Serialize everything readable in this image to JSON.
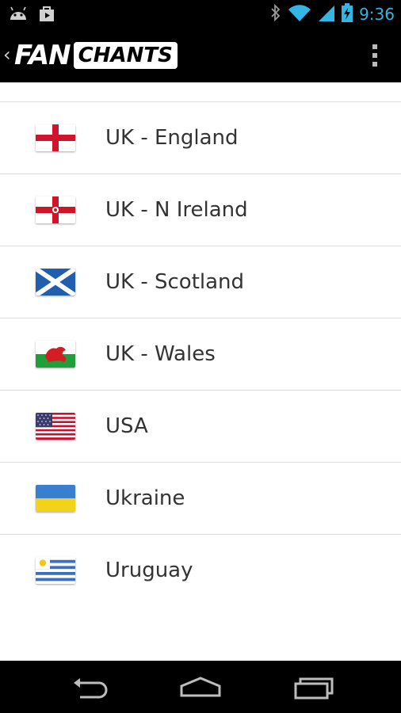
{
  "status_bar": {
    "time": "9:36",
    "icons": [
      "android-icon",
      "bag-icon",
      "bluetooth-icon",
      "wifi-icon",
      "signal-icon",
      "battery-icon"
    ]
  },
  "action_bar": {
    "back_icon": "back-chevron-icon",
    "logo_fan": "FAN",
    "logo_chants": "CHANTS",
    "overflow_icon": "overflow-menu-icon"
  },
  "countries": [
    {
      "label": "UK - England",
      "flag": "england-flag-icon"
    },
    {
      "label": "UK - N Ireland",
      "flag": "northern-ireland-flag-icon"
    },
    {
      "label": "UK - Scotland",
      "flag": "scotland-flag-icon"
    },
    {
      "label": "UK - Wales",
      "flag": "wales-flag-icon"
    },
    {
      "label": "USA",
      "flag": "usa-flag-icon"
    },
    {
      "label": "Ukraine",
      "flag": "ukraine-flag-icon"
    },
    {
      "label": "Uruguay",
      "flag": "uruguay-flag-icon"
    }
  ],
  "nav_bar": {
    "icons": [
      "back-icon",
      "home-icon",
      "recent-apps-icon"
    ]
  }
}
